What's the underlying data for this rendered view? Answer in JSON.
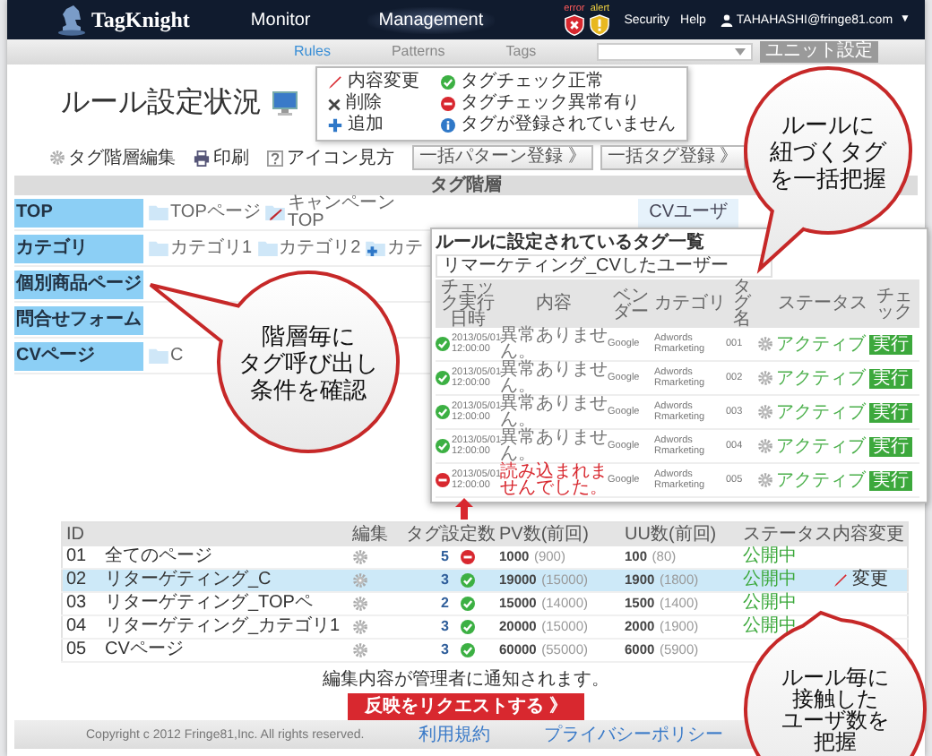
{
  "header": {
    "logo": "TagKnight",
    "nav": [
      {
        "label": "Monitor",
        "selected": false
      },
      {
        "label": "Management",
        "selected": true
      }
    ],
    "alerts": [
      {
        "kind": "error",
        "label": "error"
      },
      {
        "kind": "alert",
        "label": "alert"
      }
    ],
    "links": [
      "Security",
      "Help"
    ],
    "user": "TAHAHASHI@fringe81.com",
    "user_caret": "▼"
  },
  "subnav": {
    "tabs": [
      {
        "label": "Rules",
        "selected": true
      },
      {
        "label": "Patterns",
        "selected": false
      },
      {
        "label": "Tags",
        "selected": false
      }
    ],
    "unit_button": "ユニット設定"
  },
  "page_title": "ルール設定状況",
  "legend": [
    {
      "kind": "edit",
      "label": "内容変更"
    },
    {
      "kind": "delete",
      "label": "削除"
    },
    {
      "kind": "add",
      "label": "追加"
    },
    {
      "kind": "ok",
      "label": "タグチェック正常"
    },
    {
      "kind": "error",
      "label": "タグチェック異常有り"
    },
    {
      "kind": "missing",
      "label": "タグが登録されていません"
    }
  ],
  "toolbar": {
    "tools": [
      {
        "kind": "hierarchy",
        "label": "タグ階層編集"
      },
      {
        "kind": "print",
        "label": "印刷"
      },
      {
        "kind": "help",
        "label": "アイコン見方"
      }
    ],
    "buttons": [
      "一括パターン登録 》",
      "一括タグ登録 》"
    ]
  },
  "tag_hierarchy": {
    "title": "タグ階層",
    "levels": [
      {
        "label": "TOP",
        "folders": [
          {
            "kind": "folder",
            "label": "TOPページ"
          },
          {
            "kind": "edit",
            "label": "キャンペーン TOP"
          }
        ],
        "tag": "CVユーザ"
      },
      {
        "label": "カテゴリ",
        "folders": [
          {
            "kind": "folder",
            "label": "カテゴリ1"
          },
          {
            "kind": "folder",
            "label": "カテゴリ2"
          },
          {
            "kind": "add",
            "label": "カテ"
          }
        ]
      },
      {
        "label": "個別商品ページ"
      },
      {
        "label": "問合せフォーム"
      },
      {
        "label": "CVページ",
        "folders": [
          {
            "kind": "folder",
            "label": "C"
          }
        ]
      }
    ]
  },
  "tag_popup": {
    "title": "ルールに設定されているタグ一覧",
    "rule": "リマーケティング_CVしたユーザー",
    "columns": [
      "チェック実行日時",
      "内容",
      "ベンダー",
      "カテゴリ",
      "タグ名",
      "ステータス",
      "チェック"
    ],
    "rows": [
      {
        "kind": "ok",
        "checked_at": "2013/05/01 12:00:00",
        "result": "異常ありません。",
        "vendor": "Google",
        "category": "Adwords Rmarketing",
        "tag": "001",
        "state": "アクティブ",
        "action": "実行"
      },
      {
        "kind": "ok",
        "checked_at": "2013/05/01 12:00:00",
        "result": "異常ありません。",
        "vendor": "Google",
        "category": "Adwords Rmarketing",
        "tag": "002",
        "state": "アクティブ",
        "action": "実行"
      },
      {
        "kind": "ok",
        "checked_at": "2013/05/01 12:00:00",
        "result": "異常ありません。",
        "vendor": "Google",
        "category": "Adwords Rmarketing",
        "tag": "003",
        "state": "アクティブ",
        "action": "実行"
      },
      {
        "kind": "ok",
        "checked_at": "2013/05/01 12:00:00",
        "result": "異常ありません。",
        "vendor": "Google",
        "category": "Adwords Rmarketing",
        "tag": "004",
        "state": "アクティブ",
        "action": "実行"
      },
      {
        "kind": "error",
        "checked_at": "2013/05/01 12:00:00",
        "result": "読み込まれませんでした。",
        "vendor": "Google",
        "category": "Adwords Rmarketing",
        "tag": "005",
        "state": "アクティブ",
        "action": "実行"
      }
    ]
  },
  "rules": {
    "columns": [
      "ID",
      "編集",
      "タグ設定数",
      "PV数(前回)",
      "UU数(前回)",
      "ステータス",
      "内容変更"
    ],
    "rows": [
      {
        "id": "01",
        "name": "全てのページ",
        "selected": false,
        "tag_count": "5",
        "kind": "error",
        "pv": "1000",
        "pv_prev": "(900)",
        "uu": "100",
        "uu_prev": "(80)",
        "status": "公開中"
      },
      {
        "id": "02",
        "name": "リターゲティング_C",
        "selected": true,
        "tag_count": "3",
        "kind": "ok",
        "pv": "19000",
        "pv_prev": "(15000)",
        "uu": "1900",
        "uu_prev": "(1800)",
        "status": "公開中",
        "change": "変更"
      },
      {
        "id": "03",
        "name": "リターゲティング_TOPペ",
        "selected": false,
        "tag_count": "2",
        "kind": "ok",
        "pv": "15000",
        "pv_prev": "(14000)",
        "uu": "1500",
        "uu_prev": "(1400)",
        "status": "公開中"
      },
      {
        "id": "04",
        "name": "リターゲティング_カテゴリ1",
        "selected": false,
        "tag_count": "3",
        "kind": "ok",
        "pv": "20000",
        "pv_prev": "(15000)",
        "uu": "2000",
        "uu_prev": "(1900)",
        "status": "公開中"
      },
      {
        "id": "05",
        "name": "CVページ",
        "selected": false,
        "tag_count": "3",
        "kind": "ok",
        "pv": "60000",
        "pv_prev": "(55000)",
        "uu": "6000",
        "uu_prev": "(5900)"
      }
    ]
  },
  "note": "編集内容が管理者に通知されます。",
  "request_button": "反映をリクエストする 》",
  "footer": {
    "copyright": "Copyright c 2012 Fringe81,Inc. All rights reserved.",
    "links": [
      "利用規約",
      "プライバシーポリシー"
    ]
  },
  "callouts": [
    {
      "lines": [
        "階層毎に",
        "タグ呼び出し",
        "条件を確認"
      ]
    },
    {
      "lines": [
        "ルールに",
        "紐づくタグ",
        "を一括把握"
      ]
    },
    {
      "lines": [
        "ルール毎に",
        "接触した",
        "ユーザ数を",
        "把握"
      ]
    }
  ]
}
